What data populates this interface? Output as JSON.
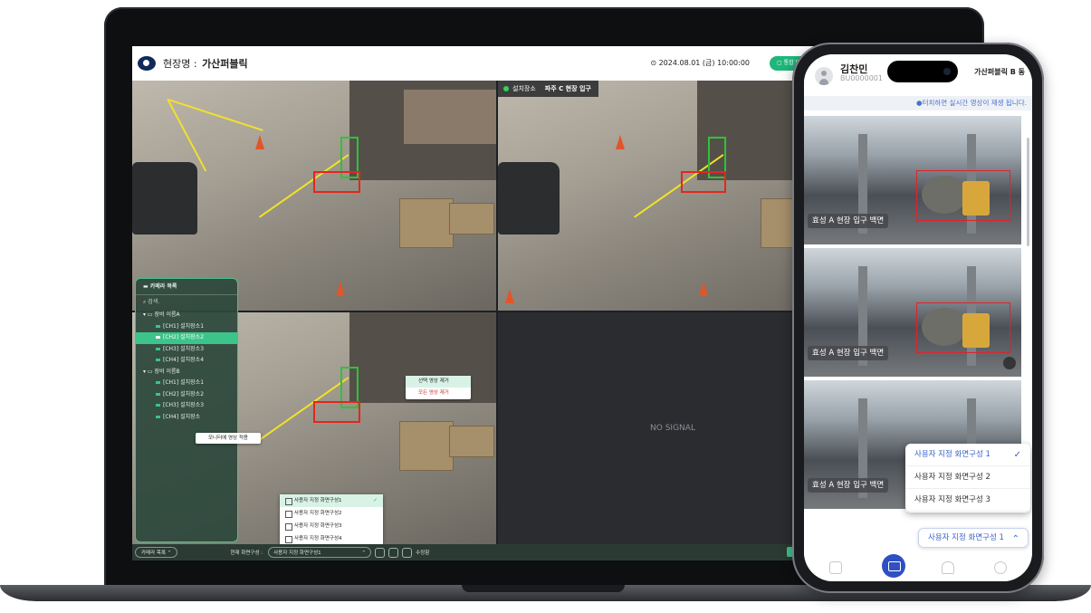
{
  "laptop": {
    "header": {
      "site_prefix": "현장명 :",
      "site_name": "가산퍼블릭",
      "datetime": "⊙ 2024.08.01 (금) 10:00:00",
      "button_label": "▢ 통합 모니..."
    },
    "panes": [
      {
        "label": "설치장소",
        "title": "파주 C 현장 입구"
      }
    ],
    "no_signal": "NO SIGNAL",
    "camera_panel": {
      "title": "카메라 목록",
      "search_placeholder": "검색.",
      "items": [
        {
          "label": "장비 이름A",
          "type": "group"
        },
        {
          "label": "[CH1] 설치장소1",
          "type": "channel"
        },
        {
          "label": "[CH2] 설치장소2",
          "type": "channel",
          "selected": true
        },
        {
          "label": "[CH3] 설치장소3",
          "type": "channel"
        },
        {
          "label": "[CH4] 설치장소4",
          "type": "channel"
        },
        {
          "label": "장비 이름B",
          "type": "group"
        },
        {
          "label": "[CH1] 설치장소1",
          "type": "channel"
        },
        {
          "label": "[CH2] 설치장소2",
          "type": "channel"
        },
        {
          "label": "[CH3] 설치장소3",
          "type": "channel"
        },
        {
          "label": "[CH4] 설치장소",
          "type": "channel"
        }
      ]
    },
    "apply_popup": "모니터에 영상 적용",
    "video_context_menu": [
      "선택 영상 제거",
      "모든 영상 제거"
    ],
    "layout_menu": {
      "options": [
        "사용자 지정 화면구성1",
        "사용자 지정 화면구성2",
        "사용자 지정 화면구성3",
        "사용자 지정 화면구성4"
      ],
      "selected_index": 0
    },
    "bottom_bar": {
      "camlist_button": "카메라 목록 ⌃",
      "layout_label": "현재 화면구성 :",
      "layout_value": "사용자 지정 화면구성1",
      "edit_label": "수정함"
    },
    "colors": {
      "accent": "#3cc48a",
      "header_button": "#1eb67a",
      "detect_person": "#2fc23a",
      "detect_alert": "#e2271c",
      "zone_line": "#f1e12a"
    }
  },
  "phone": {
    "user_name": "김찬민",
    "user_id": "BU0000001",
    "site": "가산퍼블릭 B 동",
    "hint": "●터치하면 실시간 영상이 재생 됩니다.",
    "feeds": [
      {
        "label": "효성 A 현장 입구 백면"
      },
      {
        "label": "효성 A 현장 입구 백면"
      },
      {
        "label": "효성 A 현장 입구 백면"
      }
    ],
    "layout_menu": {
      "options": [
        "사용자 지정 화면구성 1",
        "사용자 지정 화면구성 2",
        "사용자 지정 화면구성 3"
      ],
      "selected_index": 0
    },
    "layout_select": "사용자 지정 화면구성 1",
    "nav_icons": [
      "home-icon",
      "monitor-icon",
      "bell-icon",
      "settings-icon"
    ],
    "colors": {
      "accent": "#3b62c9",
      "hint": "#4d6fcf"
    }
  }
}
